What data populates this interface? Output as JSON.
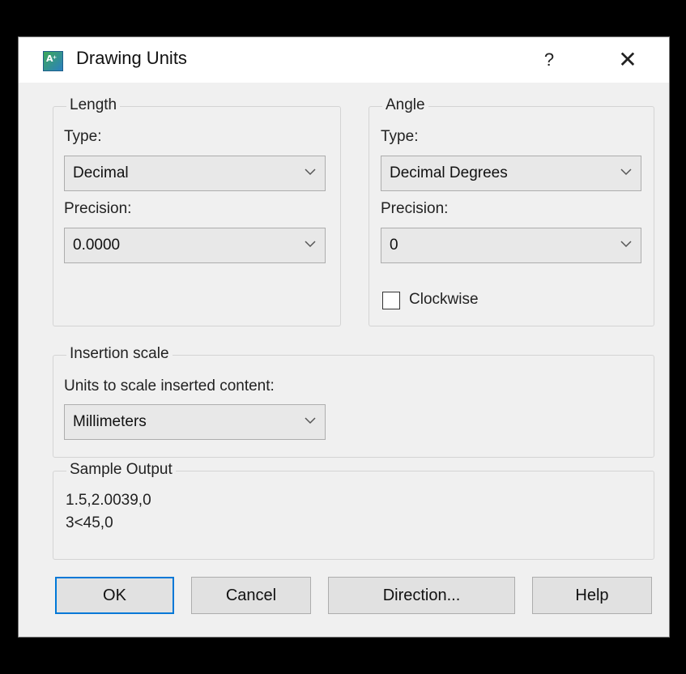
{
  "window": {
    "title": "Drawing Units",
    "help_glyph": "?",
    "close_glyph": "✕"
  },
  "length": {
    "legend": "Length",
    "type_label": "Type:",
    "type_value": "Decimal",
    "precision_label": "Precision:",
    "precision_value": "0.0000"
  },
  "angle": {
    "legend": "Angle",
    "type_label": "Type:",
    "type_value": "Decimal Degrees",
    "precision_label": "Precision:",
    "precision_value": "0",
    "clockwise_label": "Clockwise",
    "clockwise_checked": false
  },
  "insertion": {
    "legend": "Insertion scale",
    "units_label": "Units to scale inserted content:",
    "units_value": "Millimeters"
  },
  "sample": {
    "legend": "Sample Output",
    "line1": "1.5,2.0039,0",
    "line2": "3<45,0"
  },
  "buttons": {
    "ok": "OK",
    "cancel": "Cancel",
    "direction": "Direction...",
    "help": "Help"
  }
}
